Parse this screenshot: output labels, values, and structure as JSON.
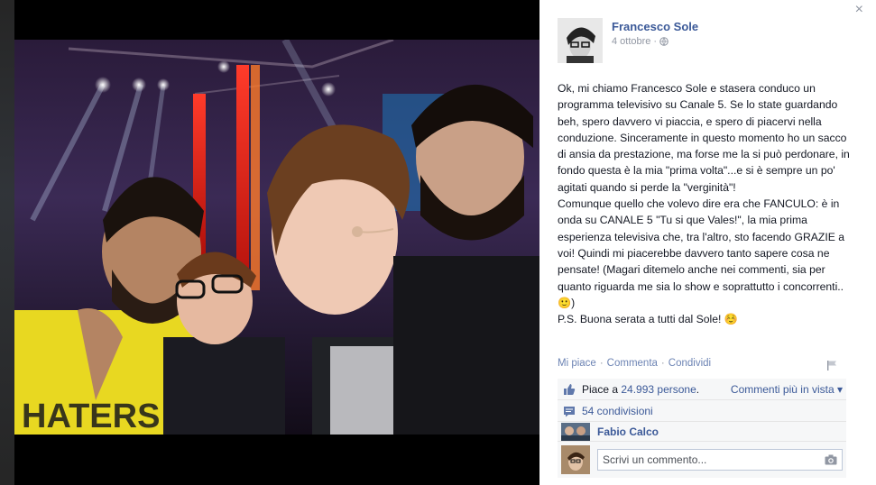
{
  "lightbox": {
    "close_glyph": "×"
  },
  "post": {
    "author_name": "Francesco Sole",
    "date": "4 ottobre",
    "date_separator": "·",
    "audience_icon": "globe-icon",
    "paragraphs": [
      "Ok, mi chiamo Francesco Sole e stasera conduco un programma televisivo su Canale 5. Se lo state guardando beh, spero davvero vi piaccia, e spero di piacervi nella conduzione. Sinceramente in questo momento ho un sacco di ansia da prestazione, ma forse me la si può perdonare, in fondo questa è la mia \"prima volta\"...e si è sempre un po' agitati quando si perde la \"verginità\"!",
      "Comunque quello che volevo dire era che FANCULO: è in onda su CANALE 5 \"Tu si que Vales!\", la mia prima esperienza televisiva che, tra l'altro, sto facendo GRAZIE a voi! Quindi mi piacerebbe davvero tanto sapere cosa ne pensate! (Magari ditemelo anche nei commenti, sia per quanto riguarda me sia lo show e soprattutto i concorrenti.. 🙂)",
      "P.S. Buona serata a tutti dal Sole! ☺️"
    ]
  },
  "actions": {
    "like": "Mi piace",
    "comment": "Commenta",
    "share": "Condividi",
    "separator": "·"
  },
  "ufi": {
    "likes_prefix": "Piace a",
    "likes_count": "24.993 persone",
    "likes_suffix": ".",
    "top_comments": "Commenti più in vista ▾",
    "shares": "54 condivisioni",
    "first_commenter": "Fabio Calco",
    "comment_placeholder": "Scrivi un commento..."
  },
  "colors": {
    "link": "#3b5998",
    "muted": "#9197a3",
    "ufi_background": "#f6f7f8"
  }
}
